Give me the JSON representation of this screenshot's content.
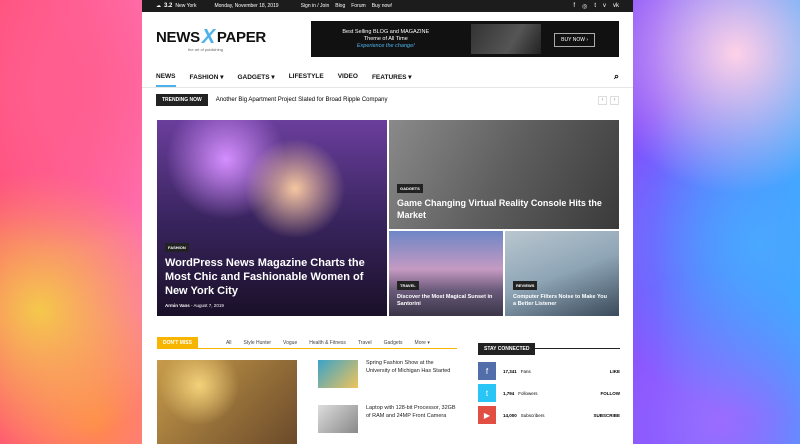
{
  "topbar": {
    "temperature": "3.2",
    "city": "New York",
    "date": "Monday, November 18, 2019",
    "links": [
      "Sign in / Join",
      "Blog",
      "Forum",
      "Buy now!"
    ],
    "social_icons": [
      "facebook-icon",
      "instagram-icon",
      "twitter-icon",
      "vimeo-icon",
      "vk-icon"
    ]
  },
  "logo": {
    "left": "NEWS",
    "mark": "X",
    "right": "PAPER",
    "tagline": "the art of publishing"
  },
  "banner": {
    "line1": "Best Selling BLOG and MAGAZINE",
    "line2": "Theme of All Time",
    "line3": "Experience the change!",
    "cta": "BUY NOW ›"
  },
  "nav": {
    "items": [
      {
        "label": "NEWS",
        "active": true
      },
      {
        "label": "FASHION ▾",
        "active": false
      },
      {
        "label": "GADGETS ▾",
        "active": false
      },
      {
        "label": "LIFESTYLE",
        "active": false
      },
      {
        "label": "VIDEO",
        "active": false
      },
      {
        "label": "FEATURES ▾",
        "active": false
      }
    ]
  },
  "trending": {
    "tag": "TRENDING NOW",
    "headline": "Another Big Apartment Project Slated for Broad Ripple Company"
  },
  "hero": {
    "big": {
      "category": "FASHION",
      "title": "WordPress News Magazine Charts the Most Chic and Fashionable Women of New York City",
      "author": "Armin Vans",
      "date": "August 7, 2019"
    },
    "top_right": {
      "category": "GADGETS",
      "title": "Game Changing Virtual Reality Console Hits the Market"
    },
    "bottom_left": {
      "category": "TRAVEL",
      "title": "Discover the Most Magical Sunset in Santorini"
    },
    "bottom_right": {
      "category": "REVIEWS",
      "title": "Computer Filters Noise to Make You a Better Listener"
    }
  },
  "dontmiss": {
    "tag": "DON'T MISS",
    "filters": [
      "All",
      "Style Hunter",
      "Vogue",
      "Health & Fitness",
      "Travel",
      "Gadgets",
      "More ▾"
    ]
  },
  "side_posts": [
    {
      "title": "Spring Fashion Show at the University of Michigan Has Started"
    },
    {
      "title": "Laptop with 128-bit Processor, 32GB of RAM and 24MP Front Camera"
    }
  ],
  "stay": {
    "tag": "STAY CONNECTED",
    "rows": [
      {
        "icon": "facebook-icon",
        "glyph": "f",
        "count": "17,341",
        "unit": "Fans",
        "action": "LIKE"
      },
      {
        "icon": "twitter-icon",
        "glyph": "t",
        "count": "1,794",
        "unit": "Followers",
        "action": "FOLLOW"
      },
      {
        "icon": "youtube-icon",
        "glyph": "▶",
        "count": "14,000",
        "unit": "Subscribers",
        "action": "SUBSCRIBE"
      }
    ]
  }
}
